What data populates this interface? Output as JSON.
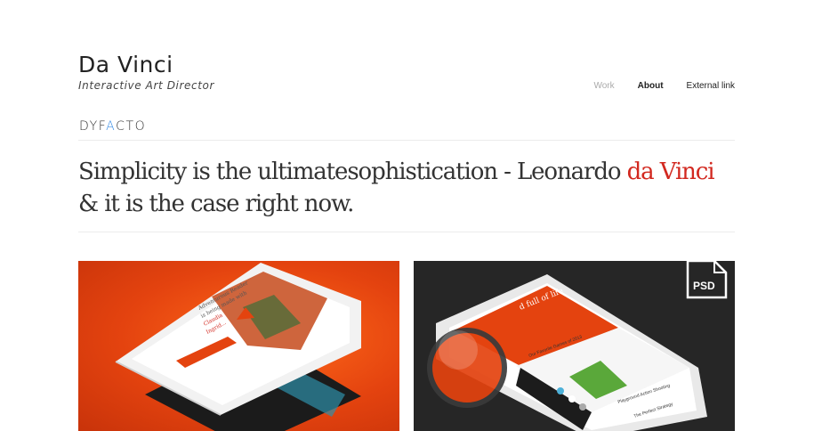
{
  "header": {
    "title": "Da Vinci",
    "subtitle": "Interactive Art Director"
  },
  "nav": {
    "items": [
      {
        "label": "Work"
      },
      {
        "label": "About"
      },
      {
        "label": "External link"
      }
    ]
  },
  "brand": {
    "prefix": "DYF",
    "accent": "A",
    "suffix": "CTO"
  },
  "quote": {
    "part1": "Simplicity is the ultimatesophistication - Leonardo ",
    "highlight": "da Vinci",
    "part2": " & it is the case right now."
  },
  "portfolio": {
    "items": [
      {
        "screen_lines": [
          "Adventurous Reader",
          "is being made with",
          "Claudia",
          "Ingrid..."
        ]
      },
      {
        "badge": "PSD",
        "screen_lines": [
          "d full of life",
          "Our Favorite Games of 2013",
          "Playground Action Shooting",
          "The Perfect Strategy"
        ]
      }
    ]
  },
  "colors": {
    "accent_red": "#d2281f",
    "brand_accent_blue": "#3a8ee6",
    "card1_bg": "#e4430f",
    "card2_bg": "#262626"
  }
}
